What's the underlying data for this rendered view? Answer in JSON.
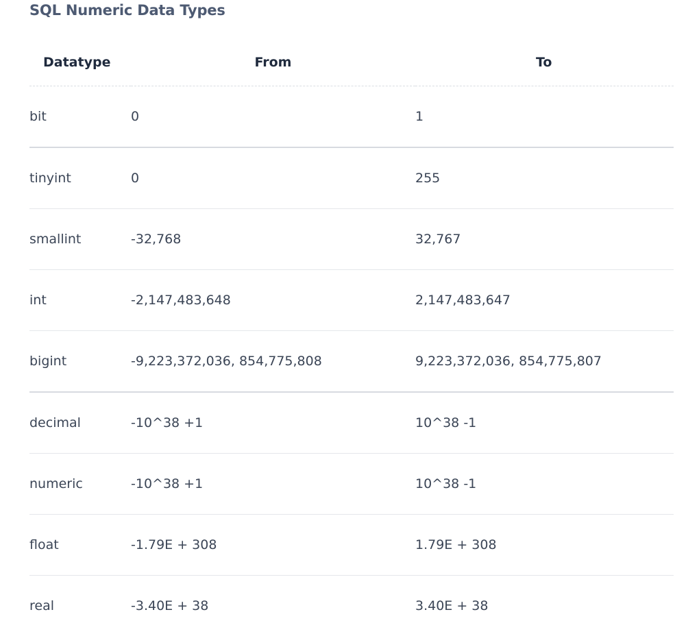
{
  "title": "SQL Numeric Data Types",
  "table": {
    "headers": [
      "Datatype",
      "From",
      "To"
    ],
    "rows": [
      {
        "type": "bit",
        "from": "0",
        "to": "1"
      },
      {
        "type": "tinyint",
        "from": "0",
        "to": "255"
      },
      {
        "type": "smallint",
        "from": "-32,768",
        "to": "32,767"
      },
      {
        "type": "int",
        "from": "-2,147,483,648",
        "to": "2,147,483,647"
      },
      {
        "type": "bigint",
        "from": "-9,223,372,036, 854,775,808",
        "to": "9,223,372,036, 854,775,807"
      },
      {
        "type": "decimal",
        "from": "-10^38 +1",
        "to": "10^38 -1"
      },
      {
        "type": "numeric",
        "from": "-10^38 +1",
        "to": "10^38 -1"
      },
      {
        "type": "float",
        "from": "-1.79E + 308",
        "to": "1.79E + 308"
      },
      {
        "type": "real",
        "from": "-3.40E + 38",
        "to": "3.40E + 38"
      }
    ]
  }
}
